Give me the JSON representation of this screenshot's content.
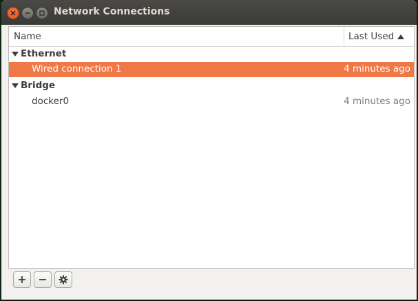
{
  "window": {
    "title": "Network Connections",
    "controls": [
      "close-icon",
      "minimize-icon",
      "maximize-icon"
    ]
  },
  "table": {
    "columns": {
      "name": "Name",
      "last_used": "Last Used"
    },
    "sort": "descending-by-last-used",
    "groups": [
      {
        "label": "Ethernet",
        "expanded": true,
        "items": [
          {
            "name": "Wired connection 1",
            "last_used": "4 minutes ago",
            "selected": true
          }
        ]
      },
      {
        "label": "Bridge",
        "expanded": true,
        "items": [
          {
            "name": "docker0",
            "last_used": "4 minutes ago",
            "selected": false
          }
        ]
      }
    ]
  },
  "toolbar": {
    "buttons": [
      "add-icon",
      "remove-icon",
      "gear-icon"
    ]
  },
  "colors": {
    "selection": "#f07746",
    "titlebar": "#3c3b37",
    "close_button": "#e95420"
  }
}
